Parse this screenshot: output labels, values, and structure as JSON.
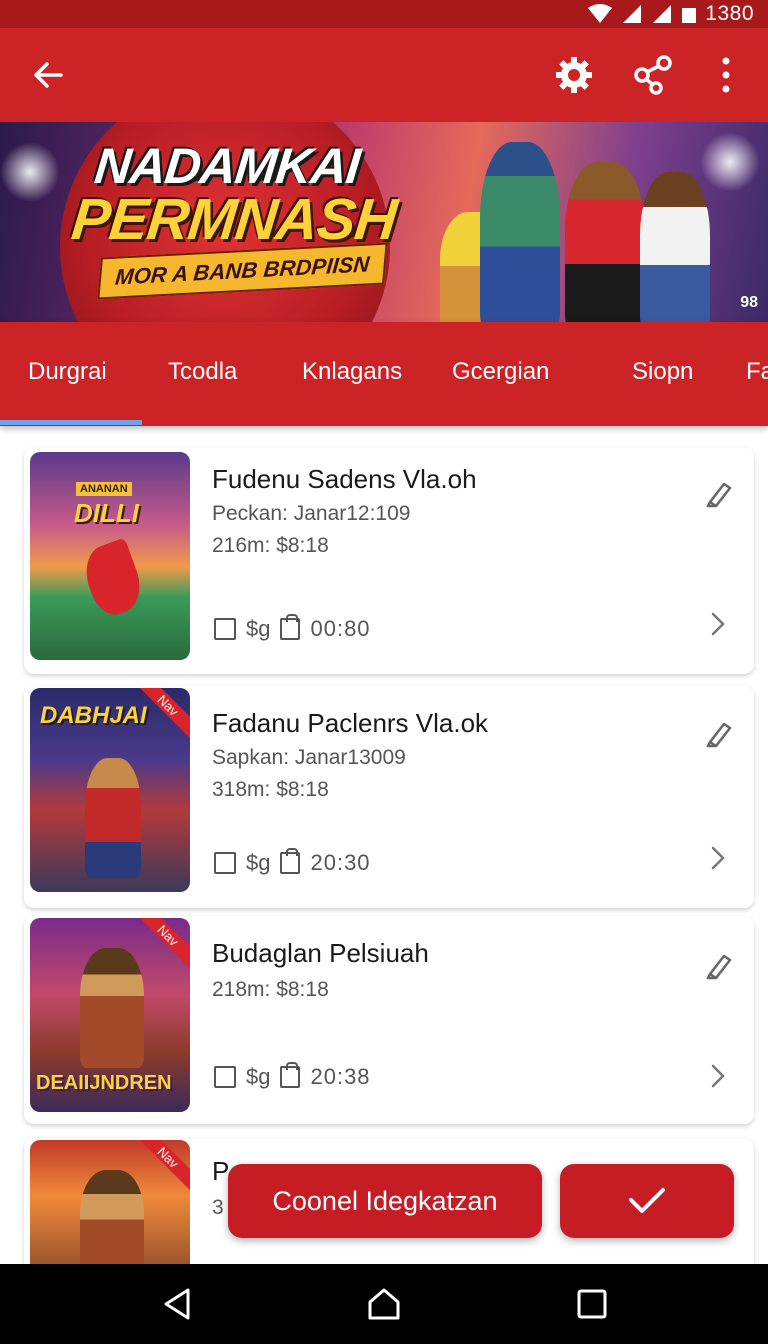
{
  "status_bar": {
    "time": "1380"
  },
  "app_bar": {
    "back_icon": "arrow-left-icon",
    "settings_icon": "gear-icon",
    "share_icon": "share-icon",
    "more_icon": "more-vertical-icon"
  },
  "banner": {
    "line1": "NADAMKAI",
    "line2": "PERMNASH",
    "subtitle": "MOR A BANB BRDPIISN",
    "badge": "98"
  },
  "tabs": [
    {
      "label": "Durgrai",
      "selected": true
    },
    {
      "label": "Tcodla"
    },
    {
      "label": "Knlagans"
    },
    {
      "label": "Gcergian"
    },
    {
      "label": "Siopn"
    },
    {
      "label": "Fa"
    }
  ],
  "items": [
    {
      "title": "Fudenu Sadens Vla.oh",
      "meta1": "Peckan: Janar12:109",
      "meta2": "216m: $8:18",
      "price": "$g",
      "time": "00:80",
      "thumb_text": "DILLI",
      "thumb_top": "ANANAN"
    },
    {
      "title": "Fadanu Paclenrs Vla.ok",
      "meta1": "Sapkan: Janar13009",
      "meta2": "318m: $8:18",
      "price": "$g",
      "time": "20:30",
      "thumb_text": "DABHJAI",
      "thumb_badge": "Nav"
    },
    {
      "title": "Budaglan Pelsiuah",
      "meta1": "",
      "meta2": "218m: $8:18",
      "price": "$g",
      "time": "20:38",
      "thumb_text": "DEAIIJNDREN",
      "thumb_badge": "Nav"
    },
    {
      "title": "P",
      "meta1": "3",
      "thumb_badge": "Nav"
    }
  ],
  "actions": {
    "primary_label": "Coonel Idegkatzan",
    "confirm_icon": "check-icon"
  },
  "nav": {
    "back": "nav-back-icon",
    "home": "nav-home-icon",
    "recents": "nav-recents-icon"
  },
  "colors": {
    "primary": "#cc2327",
    "status": "#a8191c",
    "indicator": "#6fa2e8"
  }
}
